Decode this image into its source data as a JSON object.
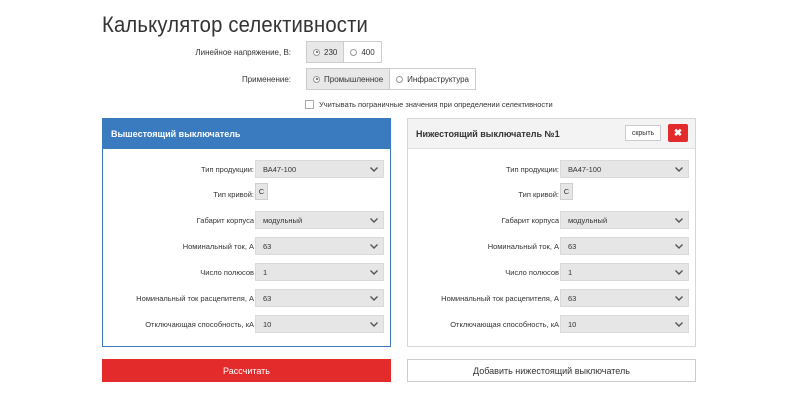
{
  "title": "Калькулятор селективности",
  "voltage": {
    "label": "Линейное напряжение, В:",
    "options": [
      "230",
      "400"
    ],
    "selected": "230"
  },
  "application": {
    "label": "Применение:",
    "options": [
      "Промышленное",
      "Инфраструктура"
    ],
    "selected": "Промышленное"
  },
  "boundary_checkbox": {
    "label": "Учитывать пограничные значения при определении селективности",
    "checked": false
  },
  "upper_panel": {
    "title": "Вышестоящий выключатель",
    "fields": [
      {
        "label": "Тип продукции:",
        "value": "ВА47-100"
      },
      {
        "label": "Тип кривой:",
        "value": "C"
      },
      {
        "label": "Габарит корпуса",
        "value": "модульный"
      },
      {
        "label": "Номинальный ток, А",
        "value": "63"
      },
      {
        "label": "Число полюсов",
        "value": "1"
      },
      {
        "label": "Номинальный ток расцепителя, А",
        "value": "63"
      },
      {
        "label": "Отключающая способность, кА",
        "value": "10"
      }
    ]
  },
  "lower_panel": {
    "title": "Нижестоящий выключатель №1",
    "hide_label": "скрыть",
    "close_glyph": "✖",
    "fields": [
      {
        "label": "Тип продукции:",
        "value": "ВА47-100"
      },
      {
        "label": "Тип кривой:",
        "value": "C"
      },
      {
        "label": "Габарит корпуса",
        "value": "модульный"
      },
      {
        "label": "Номинальный ток, А",
        "value": "63"
      },
      {
        "label": "Число полюсов",
        "value": "1"
      },
      {
        "label": "Номинальный ток расцепителя, А",
        "value": "63"
      },
      {
        "label": "Отключающая способность, кА",
        "value": "10"
      }
    ]
  },
  "actions": {
    "calculate": "Рассчитать",
    "add_lower": "Добавить нижестоящий выключатель"
  },
  "colors": {
    "primary_blue": "#3a7bbf",
    "danger_red": "#e32b2b"
  }
}
